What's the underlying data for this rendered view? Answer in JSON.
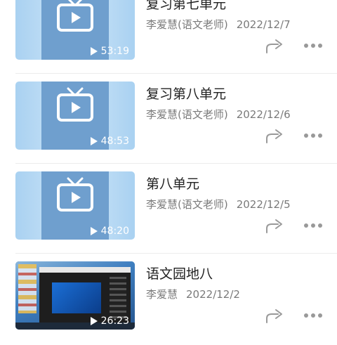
{
  "videos": [
    {
      "title": "复习第七单元",
      "author": "李爱慧(语文老师)",
      "date": "2022/12/7",
      "duration": "53:19",
      "thumb": "tv"
    },
    {
      "title": "复习第八单元",
      "author": "李爱慧(语文老师)",
      "date": "2022/12/6",
      "duration": "48:53",
      "thumb": "tv"
    },
    {
      "title": "第八单元",
      "author": "李爱慧(语文老师)",
      "date": "2022/12/5",
      "duration": "48:20",
      "thumb": "tv"
    },
    {
      "title": "语文园地八",
      "author": "李爱慧",
      "date": "2022/12/2",
      "duration": "26:23",
      "thumb": "desktop"
    }
  ],
  "icons": {
    "thumb": "tv-icon",
    "duration": "play-icon",
    "share": "share-icon",
    "more": "more-icon"
  },
  "colors": {
    "tv_panel": "#6f9fce",
    "thumb_bg": "#a9d1f1",
    "meta_text": "#7a7a7a",
    "title_text": "#222222"
  }
}
